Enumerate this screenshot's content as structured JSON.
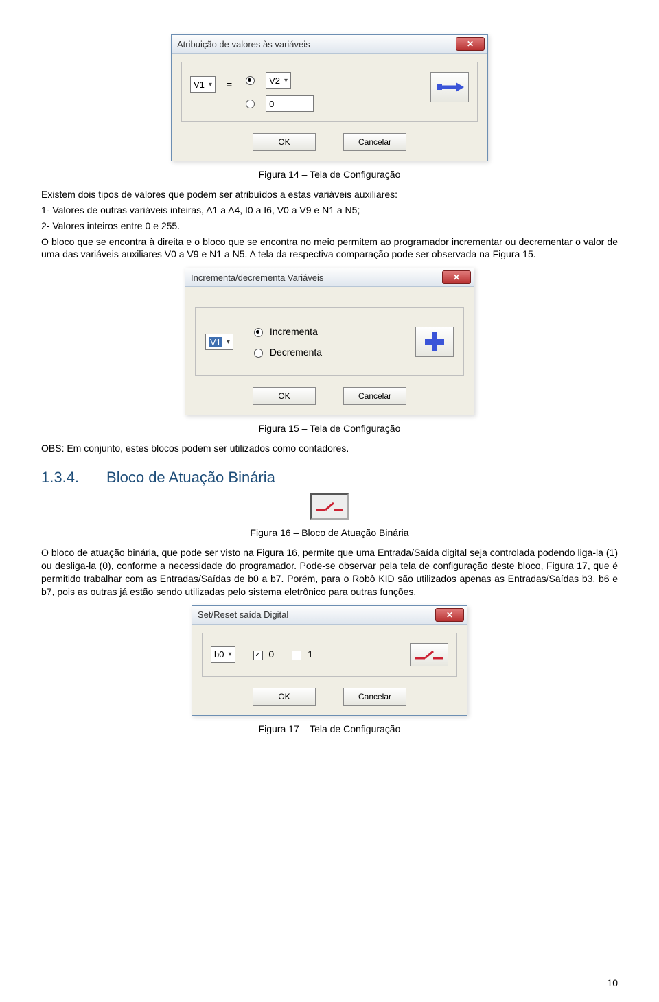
{
  "dialog14": {
    "title": "Atribuição de valores às variáveis",
    "left_var": "V1",
    "equals": "=",
    "right_var": "V2",
    "const_val": "0",
    "ok": "OK",
    "cancel": "Cancelar"
  },
  "caption14": "Figura 14 – Tela de Configuração",
  "para1": "Existem dois tipos de valores que podem ser atribuídos a estas variáveis auxiliares:",
  "list1a": " 1- Valores de outras variáveis inteiras, A1 a A4, I0 a I6, V0 a V9 e N1 a N5;",
  "list1b": " 2- Valores inteiros entre 0 e 255.",
  "para2": "O bloco que se encontra à direita e o bloco que se encontra no meio permitem ao programador incrementar ou decrementar o valor de uma das variáveis auxiliares V0 a V9 e N1 a N5. A tela da respectiva comparação pode ser observada na Figura 15.",
  "dialog15": {
    "title": "Incrementa/decrementa Variáveis",
    "var": "V1",
    "opt_inc": "Incrementa",
    "opt_dec": "Decrementa",
    "ok": "OK",
    "cancel": "Cancelar"
  },
  "caption15": "Figura 15 – Tela de Configuração",
  "obs": "OBS: Em conjunto, estes blocos podem ser utilizados como contadores.",
  "section": {
    "num": "1.3.4.",
    "title": "Bloco de Atuação Binária"
  },
  "caption16": "Figura 16 – Bloco de Atuação Binária",
  "para3": "O bloco de atuação binária, que pode ser visto na Figura 16, permite que uma Entrada/Saída digital seja controlada podendo liga-la (1) ou desliga-la (0), conforme a necessidade do programador. Pode-se observar pela tela de configuração deste bloco, Figura 17, que é permitido trabalhar com as Entradas/Saídas de b0 a b7. Porém, para o Robô KID são utilizados apenas as Entradas/Saídas b3, b6 e b7, pois as outras já estão sendo utilizadas pelo sistema eletrônico para outras funções.",
  "dialog17": {
    "title": "Set/Reset saída Digital",
    "pin": "b0",
    "lbl0": "0",
    "lbl1": "1",
    "ok": "OK",
    "cancel": "Cancelar"
  },
  "caption17": "Figura 17 – Tela de Configuração",
  "page": "10"
}
